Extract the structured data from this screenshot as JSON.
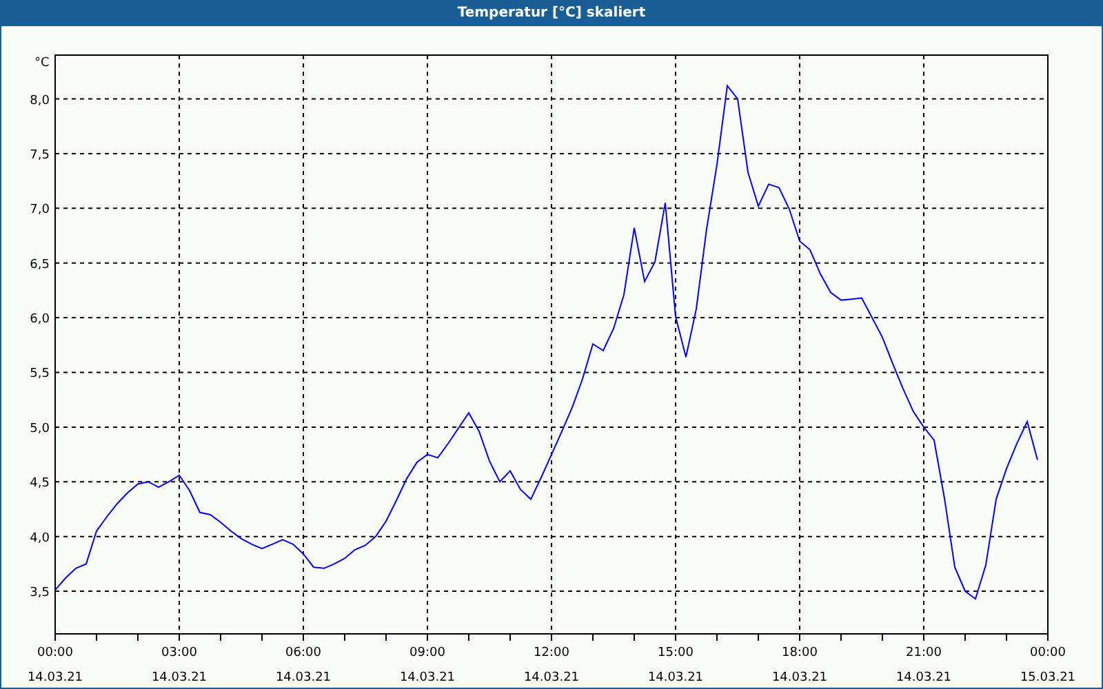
{
  "window": {
    "title": "Temperatur [°C] skaliert"
  },
  "chart": {
    "chart_data": {
      "type": "line",
      "grid": true,
      "ylabel": "°C",
      "ylim": [
        3.11,
        8.4
      ],
      "categories": [
        "00:00\n14.03.21",
        null,
        null,
        null,
        null,
        null,
        null,
        null,
        null,
        null,
        null,
        null,
        "03:00\n14.03.21",
        null,
        null,
        null,
        null,
        null,
        null,
        null,
        null,
        null,
        null,
        null,
        "06:00\n14.03.21",
        null,
        null,
        null,
        null,
        null,
        null,
        null,
        null,
        null,
        null,
        null,
        "09:00\n14.03.21",
        null,
        null,
        null,
        null,
        null,
        null,
        null,
        null,
        null,
        null,
        null,
        "12:00\n14.03.21",
        null,
        null,
        null,
        null,
        null,
        null,
        null,
        null,
        null,
        null,
        null,
        "15:00\n14.03.21",
        null,
        null,
        null,
        null,
        null,
        null,
        null,
        null,
        null,
        null,
        null,
        "18:00\n14.03.21",
        null,
        null,
        null,
        null,
        null,
        null,
        null,
        null,
        null,
        null,
        null,
        "21:00\n14.03.21",
        null,
        null,
        null,
        null,
        null,
        null,
        null,
        null,
        null,
        null,
        null,
        "00:00\n15.03.21"
      ],
      "yticks": [
        {
          "value": 3.5,
          "label": "3,5"
        },
        {
          "value": 4,
          "label": "4,0"
        },
        {
          "value": 4.5,
          "label": "4,5"
        },
        {
          "value": 5,
          "label": "5,0"
        },
        {
          "value": 5.5,
          "label": "5,5"
        },
        {
          "value": 6,
          "label": "6,0"
        },
        {
          "value": 6.5,
          "label": "6,5"
        },
        {
          "value": 7,
          "label": "7,0"
        },
        {
          "value": 7.5,
          "label": "7,5"
        },
        {
          "value": 8,
          "label": "8,0"
        }
      ],
      "series": [
        {
          "color": "#0000ff",
          "values": [
            3.51,
            3.62,
            3.71,
            3.75,
            4.05,
            4.18,
            4.3,
            4.4,
            4.48,
            4.5,
            4.45,
            4.5,
            4.56,
            4.42,
            4.22,
            4.2,
            4.13,
            4.05,
            3.98,
            3.93,
            3.89,
            3.93,
            3.97,
            3.93,
            3.84,
            3.72,
            3.71,
            3.75,
            3.8,
            3.88,
            3.92,
            4.0,
            4.14,
            4.33,
            4.53,
            4.68,
            4.75,
            4.72,
            4.85,
            4.99,
            5.13,
            4.96,
            4.69,
            4.5,
            4.6,
            4.43,
            4.34,
            4.54,
            4.75,
            4.96,
            5.18,
            5.44,
            5.76,
            5.7,
            5.9,
            6.21,
            6.82,
            6.33,
            6.51,
            7.05,
            6.01,
            5.64,
            6.08,
            6.81,
            7.4,
            8.12,
            8.0,
            7.33,
            7.02,
            7.22,
            7.19,
            6.99,
            6.7,
            6.62,
            6.4,
            6.23,
            6.16,
            6.17,
            6.18,
            6.0,
            5.82,
            5.58,
            5.35,
            5.14,
            5.0,
            4.88,
            4.35,
            3.72,
            3.5,
            3.43,
            3.74,
            4.34,
            4.62,
            4.85,
            5.05,
            4.7,
            null
          ]
        }
      ]
    }
  }
}
